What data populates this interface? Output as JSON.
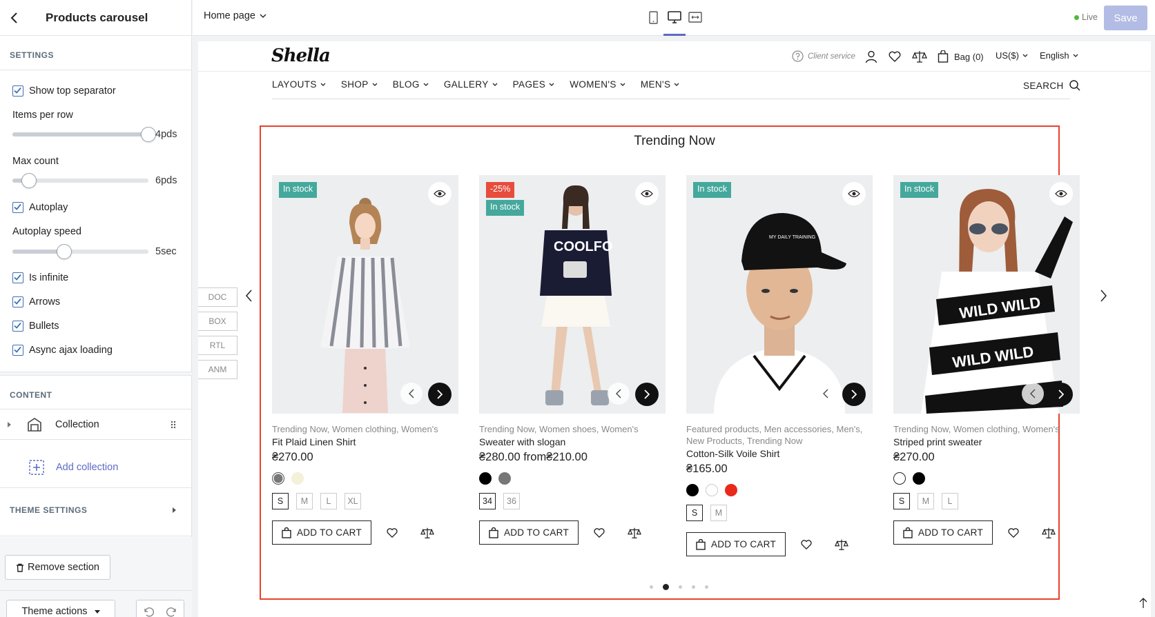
{
  "sidebar": {
    "title": "Products carousel",
    "settings_header": "SETTINGS",
    "show_top_separator": "Show top separator",
    "items_per_row_label": "Items per row",
    "items_per_row_value": "4pds",
    "items_per_row_level": 1.0,
    "max_count_label": "Max count",
    "max_count_value": "6pds",
    "max_count_level": 0.12,
    "autoplay": "Autoplay",
    "autoplay_speed_label": "Autoplay speed",
    "autoplay_speed_value": "5sec",
    "autoplay_speed_level": 0.38,
    "is_infinite": "Is infinite",
    "arrows": "Arrows",
    "bullets": "Bullets",
    "async_ajax": "Async ajax loading",
    "content_header": "CONTENT",
    "collection": "Collection",
    "add_collection": "Add collection",
    "theme_settings": "THEME SETTINGS",
    "remove_section": "Remove section",
    "theme_actions": "Theme actions"
  },
  "topbar": {
    "page": "Home page",
    "live": "Live",
    "save": "Save"
  },
  "store": {
    "logo": "Shella",
    "client_service": "Client service",
    "bag": "Bag (0)",
    "currency": "US($)",
    "language": "English",
    "menu": [
      "LAYOUTS",
      "SHOP",
      "BLOG",
      "GALLERY",
      "PAGES",
      "WOMEN'S",
      "MEN'S"
    ],
    "search": "SEARCH"
  },
  "side_buttons": [
    "DOC",
    "BOX",
    "RTL",
    "ANM"
  ],
  "section": {
    "title": "Trending Now",
    "add_to_cart": "ADD TO CART",
    "products": [
      {
        "badges": [
          "In stock"
        ],
        "sale": "",
        "categories": "Trending Now, Women clothing, Women's",
        "name": "Fit Plaid Linen Shirt",
        "price": "₴270.00",
        "swatches": [
          "#777777",
          "#f3f1d8"
        ],
        "sizes": [
          "S",
          "M",
          "L",
          "XL"
        ]
      },
      {
        "badges": [
          "In stock"
        ],
        "sale": "-25%",
        "categories": "Trending Now, Women shoes, Women's",
        "name": "Sweater with slogan",
        "price": "₴280.00 from₴210.00",
        "swatches": [
          "#000000",
          "#777777"
        ],
        "sizes": [
          "34",
          "36"
        ]
      },
      {
        "badges": [
          "In stock"
        ],
        "sale": "",
        "categories": "Featured products, Men accessories, Men's, New Products, Trending Now",
        "name": "Cotton-Silk Voile Shirt",
        "price": "₴165.00",
        "swatches": [
          "#000000",
          "#ffffff",
          "#e8291c"
        ],
        "sizes": [
          "S",
          "M"
        ]
      },
      {
        "badges": [
          "In stock"
        ],
        "sale": "",
        "categories": "Trending Now, Women clothing, Women's",
        "name": "Striped print sweater",
        "price": "₴270.00",
        "swatches": [
          "#ffffff",
          "#000000"
        ],
        "sizes": [
          "S",
          "M",
          "L"
        ]
      }
    ],
    "active_bullet": 2,
    "bullet_count": 5
  }
}
